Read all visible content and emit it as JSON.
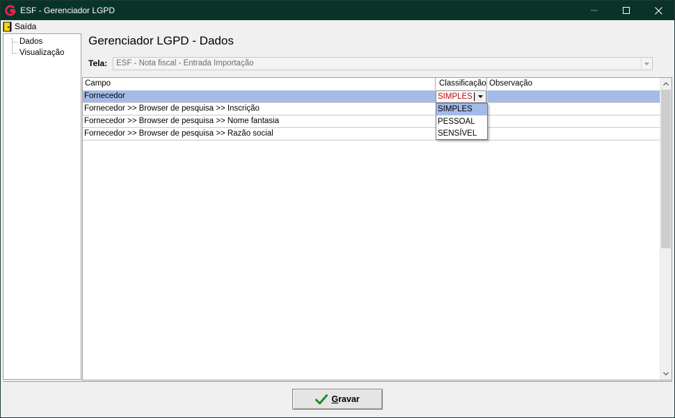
{
  "window": {
    "title": "ESF - Gerenciador LGPD",
    "colors": {
      "titlebar": "#0a3327",
      "selection": "#a4bbe9",
      "combo_text": "#c00000"
    }
  },
  "menu": {
    "items": [
      {
        "label": "Saída",
        "icon": "door-exit-icon"
      }
    ]
  },
  "tree": {
    "items": [
      {
        "label": "Dados"
      },
      {
        "label": "Visualização"
      }
    ]
  },
  "main": {
    "title": "Gerenciador LGPD - Dados",
    "tela_label": "Tela:",
    "tela_value": "ESF - Nota fiscal - Entrada Importação"
  },
  "grid": {
    "columns": [
      "Campo",
      "Classificação",
      "Observação"
    ],
    "rows": [
      {
        "campo": "Fornecedor",
        "classificacao": "SIMPLES",
        "observacao": "",
        "selected": true
      },
      {
        "campo": "Fornecedor >> Browser de pesquisa >> Inscrição",
        "classificacao": "",
        "observacao": ""
      },
      {
        "campo": "Fornecedor >> Browser de pesquisa >> Nome fantasia",
        "classificacao": "",
        "observacao": ""
      },
      {
        "campo": "Fornecedor >> Browser de pesquisa >> Razão social",
        "classificacao": "",
        "observacao": ""
      }
    ],
    "combo": {
      "value": "SIMPLES",
      "options": [
        "SIMPLES",
        "PESSOAL",
        "SENSÍVEL"
      ],
      "highlighted_option": "SIMPLES"
    }
  },
  "footer": {
    "save_label_prefix": "G",
    "save_label_rest": "ravar",
    "save_icon": "checkmark-icon"
  }
}
